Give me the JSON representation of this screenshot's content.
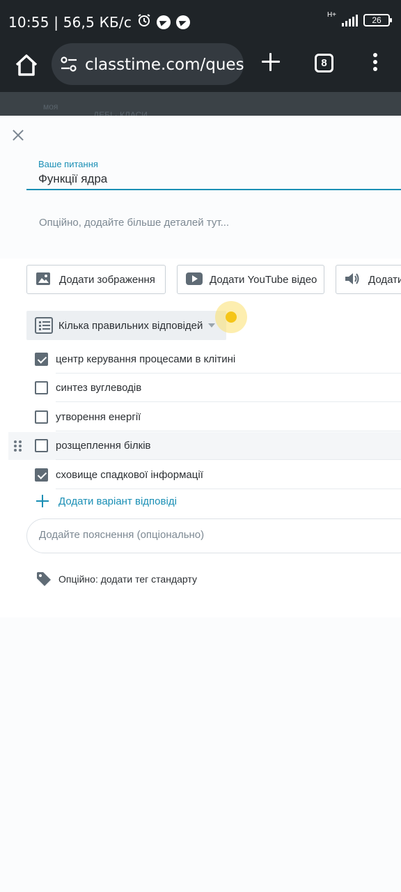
{
  "status_bar": {
    "time_speed": "10:55 | 56,5 КБ/с",
    "network": "H+",
    "battery": "26"
  },
  "browser": {
    "url": "classtime.com/quest",
    "tab_count": "8"
  },
  "background_page": {
    "text_a": "моя",
    "text_b": "ДЕБІ · КЛАСИ"
  },
  "question": {
    "label": "Ваше питання",
    "value": "Функції ядра",
    "description_placeholder": "Опційно, додайте більше деталей тут..."
  },
  "media_buttons": {
    "image": "Додати зображення",
    "youtube": "Додати YouTube відео",
    "audio": "Додати"
  },
  "question_type": {
    "selected": "Кілька правильних відповідей"
  },
  "answers": [
    {
      "text": "центр керування процесами в клітині",
      "checked": true
    },
    {
      "text": "синтез вуглеводів",
      "checked": false
    },
    {
      "text": "утворення енергії",
      "checked": false
    },
    {
      "text": "розщеплення білків",
      "checked": false
    },
    {
      "text": "сховище спадкової інформації",
      "checked": true
    }
  ],
  "add_answer_label": "Додати варіант відповіді",
  "explanation_placeholder": "Додайте пояснення (опціонально)",
  "tag_label": "Опційно: додати тег стандарту",
  "colors": {
    "accent": "#1a8fb5",
    "toolbar": "#1f2428",
    "checkbox": "#5f6b75"
  }
}
